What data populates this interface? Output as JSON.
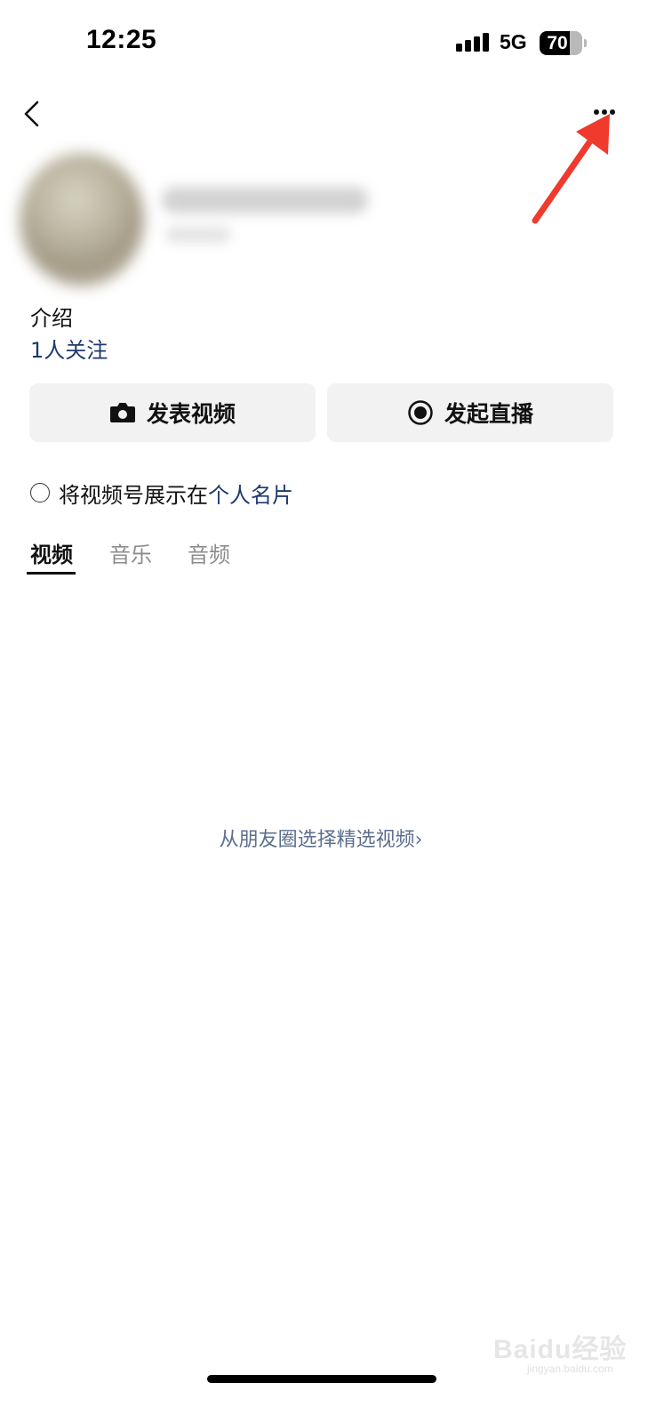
{
  "status_bar": {
    "time": "12:25",
    "network": "5G",
    "battery": "70",
    "battery_level": 0.7
  },
  "nav": {
    "back_icon": "chevron-left-icon",
    "more_icon": "more-dots-icon",
    "annotation_color": "#f03a2e"
  },
  "profile": {
    "intro": "介绍",
    "followers": "1人关注"
  },
  "actions": {
    "publish_label": "发表视频",
    "publish_icon": "camera-icon",
    "live_label": "发起直播",
    "live_icon": "record-icon"
  },
  "card_option": {
    "text": "将视频号展示在",
    "link": "个人名片",
    "checked": false
  },
  "tabs": [
    {
      "label": "视频",
      "active": true
    },
    {
      "label": "音乐",
      "active": false
    },
    {
      "label": "音频",
      "active": false
    }
  ],
  "empty_state": {
    "link": "从朋友圈选择精选视频"
  },
  "watermark": {
    "brand": "Baidu经验",
    "domain": "jingyan.baidu.com"
  },
  "colors": {
    "link": "#1e3a6e",
    "muted_link": "#5d6f8e",
    "button_bg": "#f2f2f2",
    "inactive_tab": "#8c8c8c"
  }
}
